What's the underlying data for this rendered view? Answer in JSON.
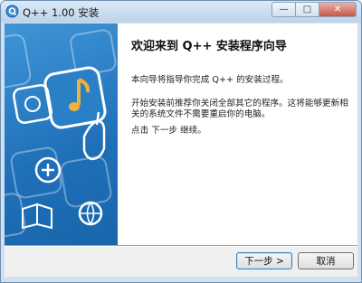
{
  "window": {
    "title": "Q++ 1.00 安装",
    "controls": {
      "minimize": "—",
      "maximize": "□",
      "close": "✕"
    }
  },
  "content": {
    "heading": "欢迎来到 Q++ 安装程序向导",
    "paragraph1": "本向导将指导你完成 Q++ 的安装过程。",
    "paragraph2": "开始安装前推荐你关闭全部其它的程序。这将能够更新相关的系统文件不需要重启你的电脑。",
    "paragraph3": "点击 下一步 继续。"
  },
  "buttons": {
    "next": "下一步 >",
    "cancel": "取消"
  },
  "colors": {
    "banner": "#1f6fb8",
    "titlebar": "#c9dcef"
  }
}
